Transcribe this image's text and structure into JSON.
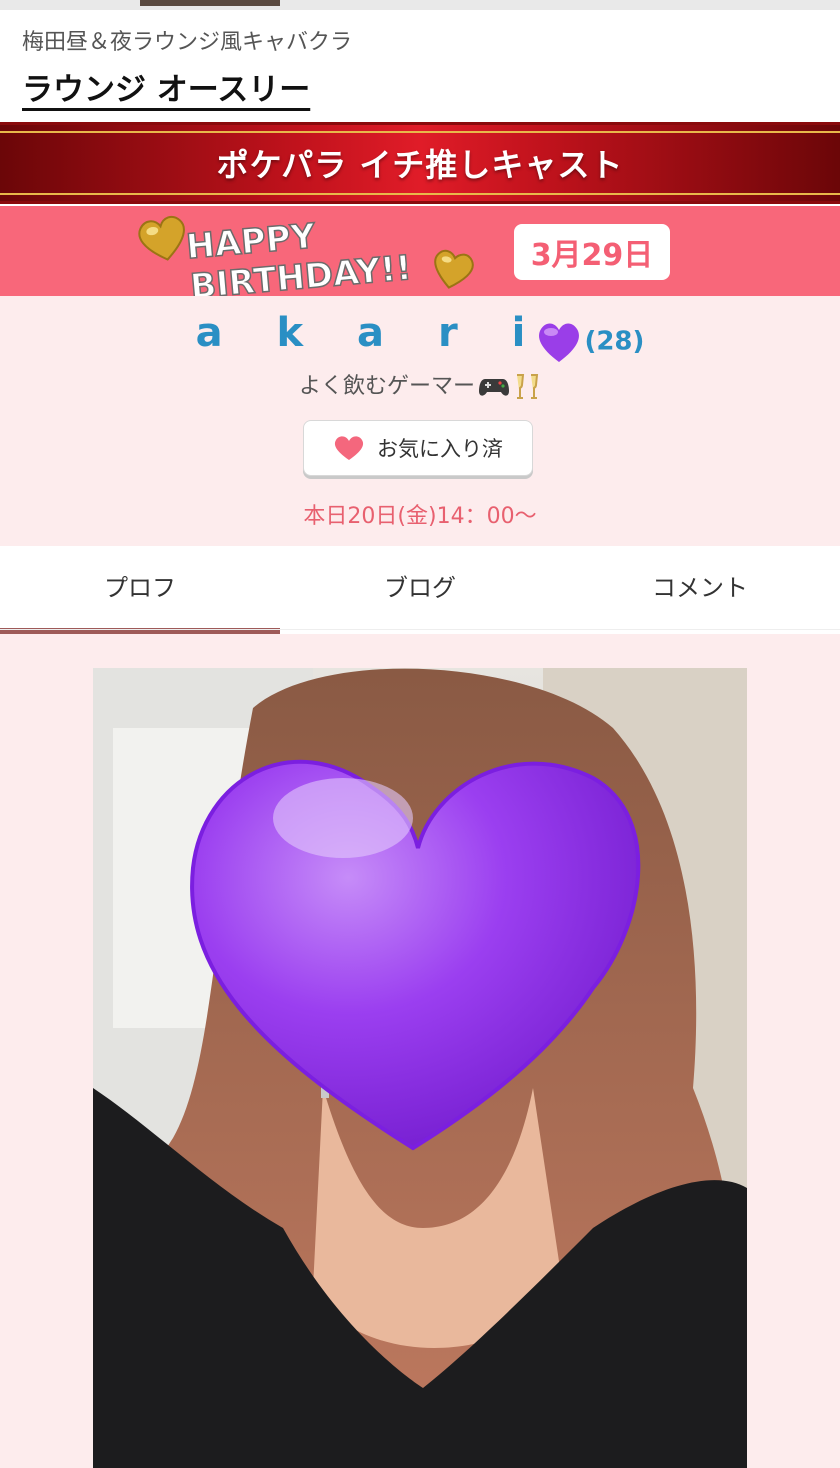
{
  "header": {
    "subtitle": "梅田昼＆夜ラウンジ風キャバクラ",
    "shop_name": "ラウンジ オースリー"
  },
  "banner": {
    "label": "ポケパラ イチ推しキャスト"
  },
  "birthday": {
    "art_text_line1": "HAPPY",
    "art_text_line2": "BIRTHDAY!!",
    "date": "3月29日"
  },
  "cast": {
    "name": "a k a r i",
    "age": "(28)",
    "catchphrase": "よく飲むゲーマー",
    "favorite_button": "お気に入り済",
    "schedule": "本日20日(金)14：00〜"
  },
  "tabs": [
    {
      "label": "プロフ",
      "active": true
    },
    {
      "label": "ブログ",
      "active": false
    },
    {
      "label": "コメント",
      "active": false
    }
  ],
  "colors": {
    "banner_red": "#c0121c",
    "birthday_pink": "#f8677a",
    "profile_bg": "#fdeced",
    "name_blue": "#2a8fc4",
    "schedule_pink": "#e8606f",
    "tab_indicator": "#9e5a58"
  }
}
